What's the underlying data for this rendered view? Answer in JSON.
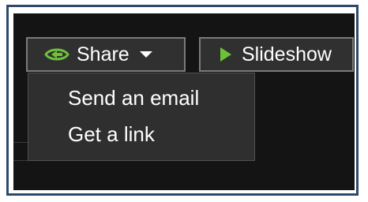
{
  "toolbar": {
    "share_label": "Share",
    "slideshow_label": "Slideshow"
  },
  "share_menu": {
    "items": [
      {
        "label": "Send an email"
      },
      {
        "label": "Get a link"
      }
    ]
  },
  "colors": {
    "background": "#141414",
    "button_bg": "#303030",
    "button_border": "#7a7a7a",
    "menu_bg": "#2f2f2f",
    "accent_green": "#6ec23a",
    "frame_border": "#2d4a6b"
  },
  "icons": {
    "share": "share-icon",
    "caret": "chevron-down-icon",
    "play": "play-icon"
  }
}
